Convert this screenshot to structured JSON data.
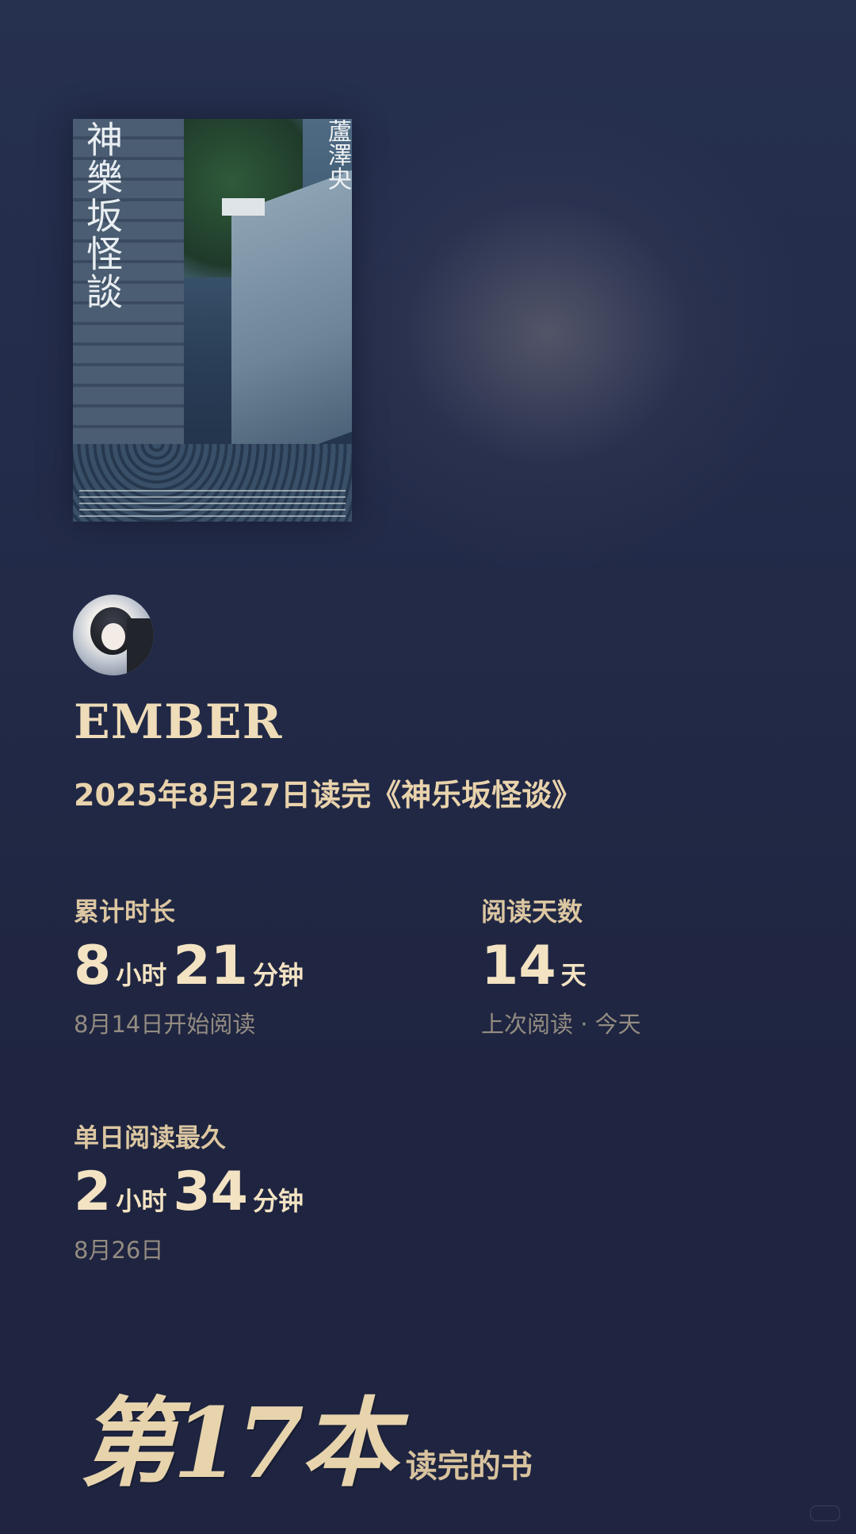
{
  "book": {
    "cover_title": "神樂坂怪談",
    "cover_author": "蘆澤央"
  },
  "user": {
    "name": "EMBER",
    "finish_text": "2025年8月27日读完《神乐坂怪谈》"
  },
  "stats": {
    "total_time": {
      "label": "累计时长",
      "hours": "8",
      "hours_unit": "小时",
      "minutes": "21",
      "minutes_unit": "分钟",
      "sub": "8月14日开始阅读"
    },
    "reading_days": {
      "label": "阅读天数",
      "days": "14",
      "days_unit": "天",
      "sub": "上次阅读 · 今天"
    },
    "longest_day": {
      "label": "单日阅读最久",
      "hours": "2",
      "hours_unit": "小时",
      "minutes": "34",
      "minutes_unit": "分钟",
      "sub": "8月26日"
    }
  },
  "rank": {
    "big": "第17本",
    "small": "读完的书"
  }
}
